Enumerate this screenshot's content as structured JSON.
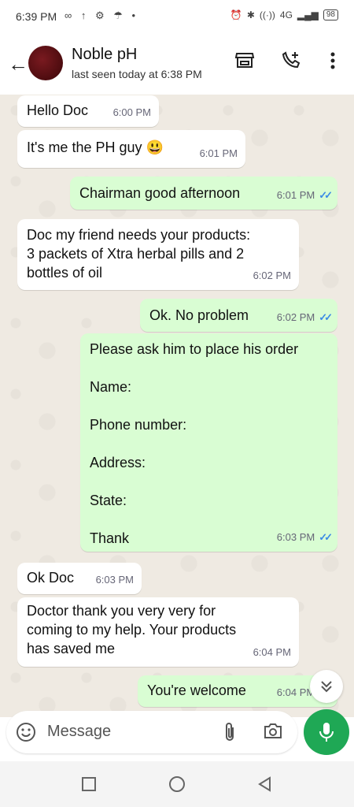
{
  "status": {
    "time": "6:39 PM",
    "battery": "98",
    "network": "4G"
  },
  "header": {
    "contact_name": "Noble pH",
    "last_seen": "last seen today at 6:38 PM"
  },
  "messages": [
    {
      "dir": "in",
      "text": "Hello Doc",
      "time": "6:00 PM"
    },
    {
      "dir": "in",
      "text": "It's me the PH guy 😃",
      "time": "6:01 PM"
    },
    {
      "dir": "out",
      "text": "Chairman good afternoon",
      "time": "6:01 PM"
    },
    {
      "dir": "in",
      "text": "Doc my friend needs your products:\n3 packets of Xtra herbal pills and 2\nbottles of oil",
      "time": "6:02 PM"
    },
    {
      "dir": "out",
      "text": "Ok. No problem",
      "time": "6:02 PM"
    },
    {
      "dir": "out",
      "text": "Please ask him to place his order\n\nName:\n\nPhone number:\n\nAddress:\n\nState:\n\nThank",
      "time": "6:03 PM"
    },
    {
      "dir": "in",
      "text": "Ok Doc",
      "time": "6:03 PM"
    },
    {
      "dir": "in",
      "text": "Doctor thank you very very for\ncoming to my help. Your products\nhas saved me",
      "time": "6:04 PM"
    },
    {
      "dir": "out",
      "text": "You're welcome",
      "time": "6:04 PM"
    }
  ],
  "composer": {
    "placeholder": "Message"
  },
  "colors": {
    "outgoing_bubble": "#d9fdd3",
    "incoming_bubble": "#ffffff",
    "chat_background": "#efeae2",
    "accent": "#1fa855",
    "read_ticks": "#3b8be6"
  },
  "icons": [
    "back-arrow-icon",
    "store-icon",
    "add-call-icon",
    "more-icon",
    "emoji-icon",
    "attach-icon",
    "camera-icon",
    "mic-icon",
    "chevron-double-down-icon",
    "recents-icon",
    "home-icon",
    "back-icon"
  ]
}
